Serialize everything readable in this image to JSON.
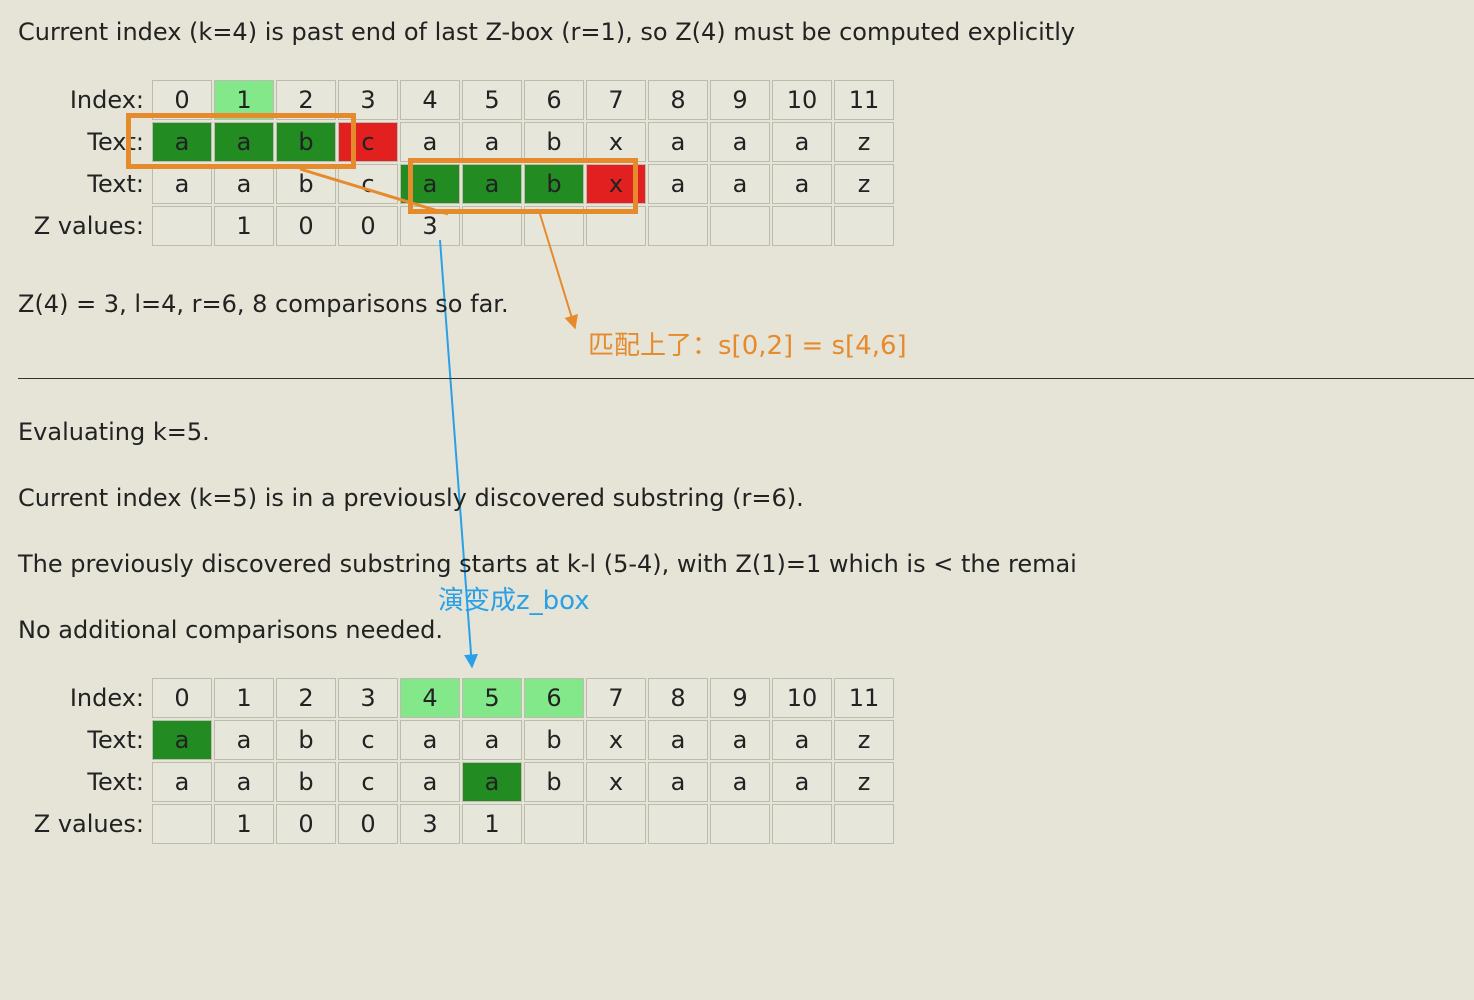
{
  "para1": "Current index (k=4) is past end of last Z-box (r=1), so Z(4) must be computed explicitly",
  "table1": {
    "headers": [
      "Index:",
      "Text:",
      "Text:",
      "Z values:"
    ],
    "index": [
      "0",
      "1",
      "2",
      "3",
      "4",
      "5",
      "6",
      "7",
      "8",
      "9",
      "10",
      "11"
    ],
    "text_a": [
      "a",
      "a",
      "b",
      "c",
      "a",
      "a",
      "b",
      "x",
      "a",
      "a",
      "a",
      "z"
    ],
    "text_b": [
      "a",
      "a",
      "b",
      "c",
      "a",
      "a",
      "b",
      "x",
      "a",
      "a",
      "a",
      "z"
    ],
    "zvals": [
      "",
      "1",
      "0",
      "0",
      "3",
      "",
      "",
      "",
      "",
      "",
      "",
      ""
    ]
  },
  "para2": "Z(4) = 3, l=4, r=6, 8 comparisons so far.",
  "anno_orange": "匹配上了：s[0,2] = s[4,6]",
  "para3": "Evaluating k=5.",
  "para4": "Current index (k=5) is in a previously discovered substring (r=6).",
  "para5": "The previously discovered substring starts at k-l (5-4), with Z(1)=1 which is < the remai",
  "anno_blue": "演变成z_box",
  "para6": "No additional comparisons needed.",
  "table2": {
    "headers": [
      "Index:",
      "Text:",
      "Text:",
      "Z values:"
    ],
    "index": [
      "0",
      "1",
      "2",
      "3",
      "4",
      "5",
      "6",
      "7",
      "8",
      "9",
      "10",
      "11"
    ],
    "text_a": [
      "a",
      "a",
      "b",
      "c",
      "a",
      "a",
      "b",
      "x",
      "a",
      "a",
      "a",
      "z"
    ],
    "text_b": [
      "a",
      "a",
      "b",
      "c",
      "a",
      "a",
      "b",
      "x",
      "a",
      "a",
      "a",
      "z"
    ],
    "zvals": [
      "",
      "1",
      "0",
      "0",
      "3",
      "1",
      "",
      "",
      "",
      "",
      "",
      ""
    ]
  },
  "colors": {
    "page_bg": "#e5e4d7",
    "cell_bg": "#e7e6da",
    "highlight_light_green": "#82e88a",
    "highlight_dark_green": "#228b22",
    "highlight_red": "#e22020",
    "orange": "#e68a2e",
    "blue": "#2aa0e6"
  },
  "table1_highlights": {
    "row_index": {
      "lightgreen": [
        1
      ]
    },
    "row_text_a": {
      "darkgreen": [
        0,
        1,
        2
      ],
      "red": [
        3
      ]
    },
    "row_text_b": {
      "darkgreen": [
        4,
        5,
        6
      ],
      "red": [
        7
      ]
    }
  },
  "table2_highlights": {
    "row_index": {
      "lightgreen": [
        4,
        5,
        6
      ]
    },
    "row_text_a": {
      "darkgreen": [
        0
      ]
    },
    "row_text_b": {
      "darkgreen": [
        5
      ]
    }
  }
}
